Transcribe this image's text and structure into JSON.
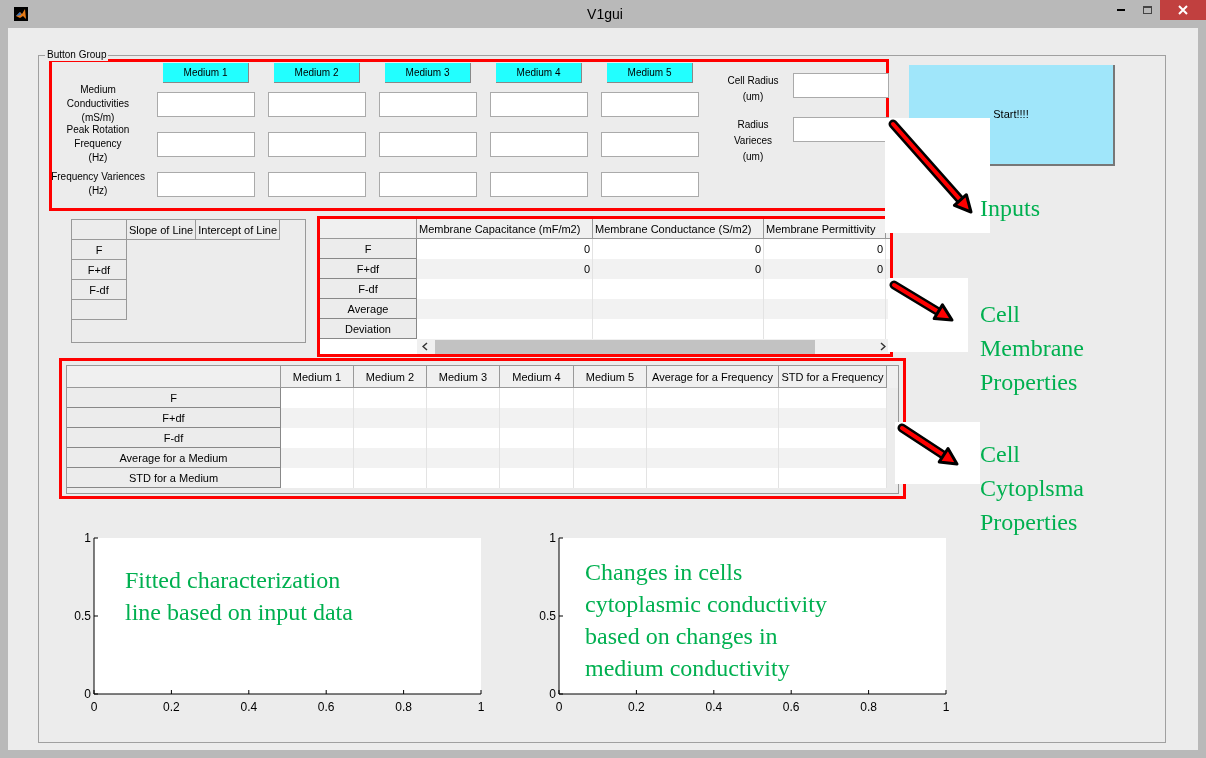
{
  "window": {
    "title": "V1gui"
  },
  "panel": {
    "title": "Button Group"
  },
  "inputs": {
    "media": [
      "Medium 1",
      "Medium 2",
      "Medium 3",
      "Medium 4",
      "Medium 5"
    ],
    "rows": [
      "Medium\nConductivities\n(mS/m)",
      "Peak Rotation\nFrequency\n(Hz)",
      "Frequency Variences\n(Hz)"
    ],
    "side_fields": [
      "Cell Radius\n(um)",
      "Radius\nVarieces\n(um)"
    ]
  },
  "start_button": {
    "label": "Start!!!!"
  },
  "fit_table": {
    "columns": [
      "Slope of Line",
      "Intercept of Line"
    ],
    "rows": [
      "F",
      "F+df",
      "F-df"
    ]
  },
  "membrane_table": {
    "columns": [
      "Membrane Capacitance (mF/m2)",
      "Membrane Conductance (S/m2)",
      "Membrane Permittivity"
    ],
    "rows": [
      {
        "header": "F",
        "cells": [
          "0",
          "0",
          "0"
        ]
      },
      {
        "header": "F+df",
        "cells": [
          "0",
          "0",
          "0"
        ]
      },
      {
        "header": "F-df",
        "cells": []
      },
      {
        "header": "Average",
        "cells": []
      },
      {
        "header": "Deviation",
        "cells": []
      }
    ]
  },
  "cytoplasm_table": {
    "columns": [
      "Medium 1",
      "Medium 2",
      "Medium 3",
      "Medium 4",
      "Medium 5",
      "Average for a Frequency",
      "STD for a Frequency"
    ],
    "rows": [
      "F",
      "F+df",
      "F-df",
      "Average for a Medium",
      "STD for a Medium"
    ]
  },
  "plots": [
    {
      "note": "Fitted characterization\nline based on input data",
      "chart_data": {
        "type": "line",
        "xlim": [
          0,
          1
        ],
        "ylim": [
          0,
          1
        ],
        "xticks": [
          0,
          0.2,
          0.4,
          0.6,
          0.8,
          1
        ],
        "yticks": [
          0,
          0.5,
          1
        ]
      }
    },
    {
      "note": "Changes in cells\ncytoplasmic conductivity\nbased on changes in\nmedium conductivity",
      "chart_data": {
        "type": "line",
        "xlim": [
          0,
          1
        ],
        "ylim": [
          0,
          1
        ],
        "xticks": [
          0,
          0.2,
          0.4,
          0.6,
          0.8,
          1
        ],
        "yticks": [
          0,
          0.5,
          1
        ]
      }
    }
  ],
  "annotations": [
    "Inputs",
    "Cell\nMembrane\nProperties",
    "Cell\nCytoplsma\nProperties"
  ]
}
